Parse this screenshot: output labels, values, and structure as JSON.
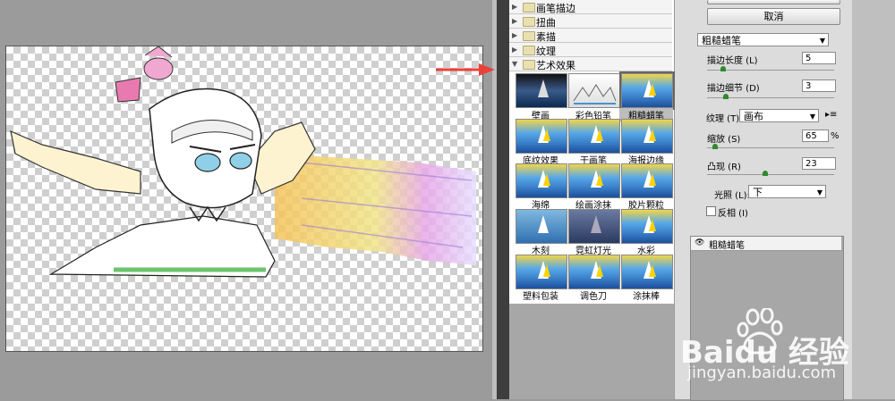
{
  "gallery": {
    "categories": [
      {
        "label": "画笔描边",
        "expanded": false
      },
      {
        "label": "扭曲",
        "expanded": false
      },
      {
        "label": "素描",
        "expanded": false
      },
      {
        "label": "纹理",
        "expanded": false
      },
      {
        "label": "艺术效果",
        "expanded": true
      }
    ],
    "filters": [
      "壁画",
      "彩色铅笔",
      "粗糙蜡笔",
      "底纹效果",
      "干画笔",
      "海报边缘",
      "海绵",
      "绘画涂抹",
      "胶片颗粒",
      "木刻",
      "霓虹灯光",
      "水彩",
      "塑料包装",
      "调色刀",
      "涂抹棒"
    ],
    "selected_filter": "粗糙蜡笔"
  },
  "panel": {
    "cancel_label": "取消",
    "filter_select": "粗糙蜡笔",
    "stroke_length_label": "描边长度 (L)",
    "stroke_length_value": "5",
    "stroke_length_level": 0.125,
    "stroke_detail_label": "描边细节 (D)",
    "stroke_detail_value": "3",
    "stroke_detail_level": 0.15,
    "texture_label": "纹理 (T):",
    "texture_value": "画布",
    "scaling_label": "缩放 (S)",
    "scaling_value": "65",
    "scaling_unit": "%",
    "scaling_level": 0.06,
    "relief_label": "凸现 (R)",
    "relief_value": "23",
    "relief_level": 0.46,
    "light_label": "光照 (L):",
    "light_value": "下",
    "invert_label": "反相 (I)",
    "invert_checked": false,
    "layer_name": "粗糙蜡笔"
  },
  "watermark": {
    "logo_text": "Baidu 经验",
    "url": "jingyan.baidu.com"
  },
  "colors": {
    "accent_arrow": "#e8413a",
    "knob": "#2f8a2f"
  }
}
